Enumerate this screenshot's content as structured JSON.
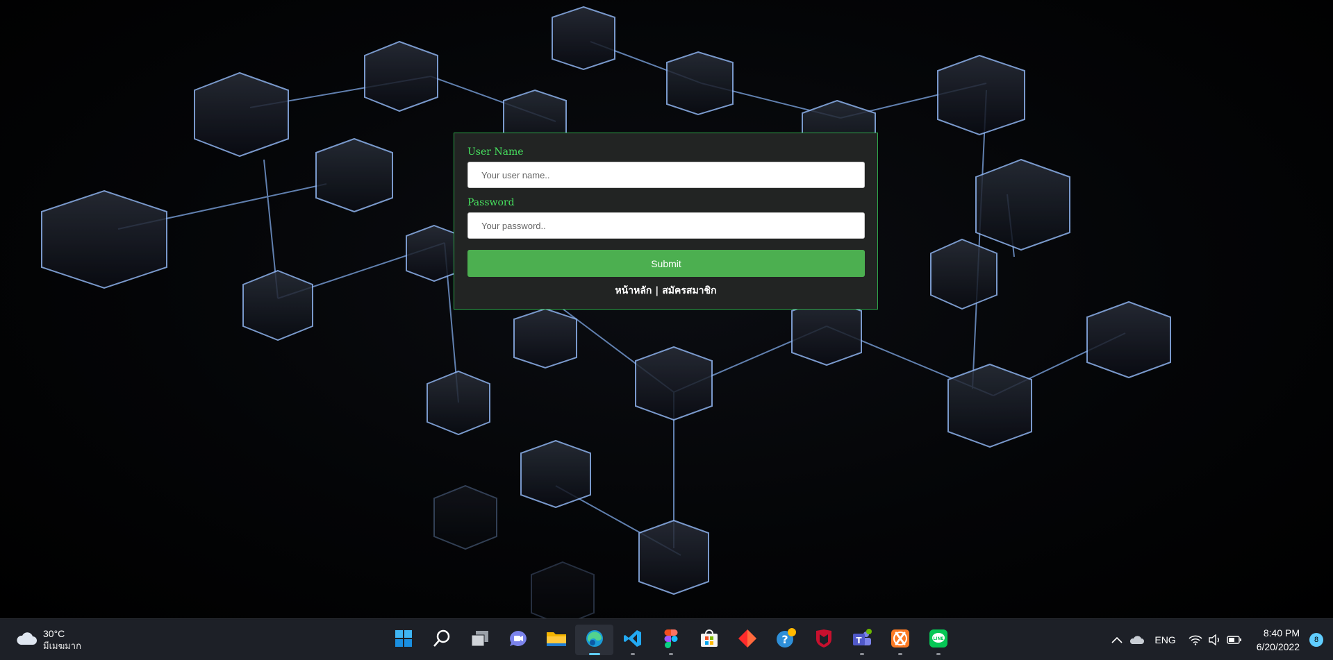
{
  "login": {
    "username_label": "User Name",
    "username_placeholder": "Your user name..",
    "password_label": "Password",
    "password_placeholder": "Your password..",
    "submit_label": "Submit",
    "link_home": "หน้าหลัก",
    "link_separator": " | ",
    "link_register": "สมัครสมาชิก"
  },
  "taskbar": {
    "weather": {
      "temp": "30°C",
      "condition": "มีเมฆมาก",
      "icon": "cloud-icon"
    },
    "apps": [
      {
        "name": "start-button",
        "icon": "windows-logo-icon"
      },
      {
        "name": "search-button",
        "icon": "search-icon"
      },
      {
        "name": "task-view-button",
        "icon": "task-view-icon"
      },
      {
        "name": "chat-button",
        "icon": "chat-icon"
      },
      {
        "name": "file-explorer-button",
        "icon": "folder-icon"
      },
      {
        "name": "edge-button",
        "icon": "edge-icon"
      },
      {
        "name": "vscode-button",
        "icon": "vscode-icon"
      },
      {
        "name": "figma-button",
        "icon": "figma-icon"
      },
      {
        "name": "store-button",
        "icon": "store-icon"
      },
      {
        "name": "red-diamond-app-button",
        "icon": "diamond-icon"
      },
      {
        "name": "help-button",
        "icon": "help-icon"
      },
      {
        "name": "mcafee-button",
        "icon": "shield-icon"
      },
      {
        "name": "teams-button",
        "icon": "teams-icon"
      },
      {
        "name": "xampp-button",
        "icon": "xampp-icon"
      },
      {
        "name": "line-button",
        "icon": "line-icon"
      }
    ],
    "tray": {
      "language": "ENG",
      "time": "8:40 PM",
      "date": "6/20/2022",
      "notification_count": "8"
    }
  },
  "colors": {
    "label_green": "#47e25f",
    "submit_green": "#4caf50",
    "card_bg": "#222423",
    "taskbar_bg": "#1d2027",
    "accent": "#60cdff"
  }
}
